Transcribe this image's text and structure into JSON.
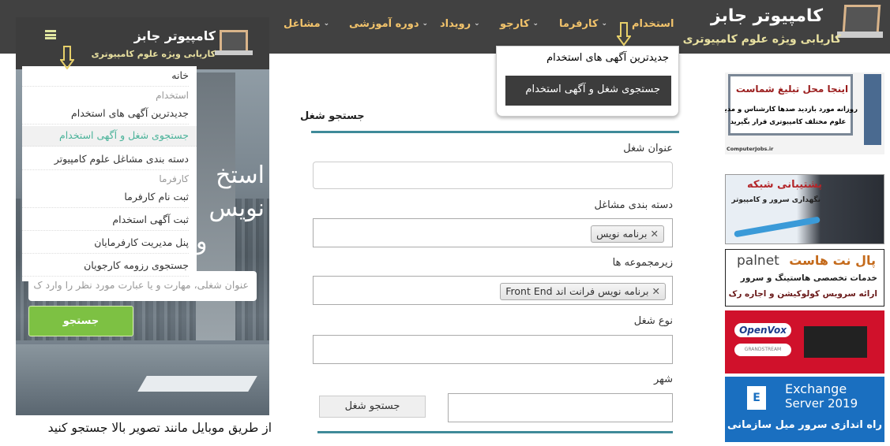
{
  "header": {
    "logo_title": "کامپیوتر جابز",
    "logo_subtitle": "کاریابی ویژه علوم کامپیوتری",
    "nav": [
      {
        "label": "استخدام",
        "chevron": false
      },
      {
        "label": "کارفرما",
        "chevron": true
      },
      {
        "label": "کارجو",
        "chevron": true
      },
      {
        "label": "رویداد",
        "chevron": true
      },
      {
        "label": "دوره آموزشی",
        "chevron": true
      },
      {
        "label": "مشاغل",
        "chevron": true
      }
    ],
    "dropdown": {
      "items": [
        "جدیدترین آگهی های استخدام",
        "جستجوی شغل و آگهی استخدام"
      ],
      "active_index": 1
    }
  },
  "mobile": {
    "logo_title": "کامپیوتر جابز",
    "logo_subtitle": "کاریابی ویژه علوم کامپیوتری",
    "menu_icon": "hamburger-icon",
    "menu": [
      {
        "label": "خانه",
        "type": "item"
      },
      {
        "label": "استخدام",
        "type": "heading"
      },
      {
        "label": "جدیدترین آگهی های استخدام",
        "type": "item"
      },
      {
        "label": "جستجوی شغل و آگهی استخدام",
        "type": "active"
      },
      {
        "label": "دسته بندی مشاغل علوم کامپیوتر",
        "type": "item"
      },
      {
        "label": "کارفرما",
        "type": "heading"
      },
      {
        "label": "ثبت نام کارفرما",
        "type": "item"
      },
      {
        "label": "ثبت آگهی استخدام",
        "type": "item"
      },
      {
        "label": "پنل مدیریت کارفرمایان",
        "type": "item"
      },
      {
        "label": "جستجوی رزومه کارجویان",
        "type": "item"
      }
    ],
    "hero_lines": [
      "استخ",
      "نویس",
      "و"
    ],
    "search_placeholder": "عنوان شغلی، مهارت و یا عبارت مورد نظر را وارد ک",
    "search_button": "جستجو",
    "caption": "از طریق موبایل مانند تصویر بالا جستجو کنید"
  },
  "form": {
    "title": "جستجو شغل",
    "job_title_label": "عنوان شغل",
    "job_title_value": "",
    "category_label": "دسته بندی مشاغل",
    "category_tags": [
      "برنامه نویس"
    ],
    "subcategory_label": "زیرمجموعه ها",
    "subcategory_tags": [
      "برنامه نویس فرانت اند Front End"
    ],
    "job_type_label": "نوع شغل",
    "job_type_value": "",
    "city_label": "شهر",
    "city_value": "",
    "submit_label": "جستجو شغل"
  },
  "ads": [
    {
      "title": "اینجا محل تبلیغ شماست",
      "line1": "روزانه مورد بازدید صدها کارشناس و مدیر",
      "line2": "علوم مختلف کامپیوتری قرار بگیرید",
      "brand": "ComputerJobs.ir"
    },
    {
      "title": "پشتیبانی شبکه",
      "line1": "نگهداری سرور و کامپیوتر"
    },
    {
      "title": "پال نت هاست",
      "brand": "palnet",
      "line1": "خدمات تخصصی هاستینگ و سرور",
      "line2": "ارائه سرویس کولوکیشن و اجاره رک"
    },
    {
      "brand": "OpenVox",
      "brand2": "GRANDSTREAM"
    },
    {
      "title": "Exchange",
      "title2": "Server 2019",
      "line1": "راه اندازی سرور میل سازمانی"
    }
  ],
  "colors": {
    "topbar": "#414141",
    "nav_text": "#f2c36b",
    "accent_line": "#3f8a99",
    "search_green": "#7dc143",
    "ad_red": "#d0112b",
    "ad_blue": "#1a6fc0"
  }
}
